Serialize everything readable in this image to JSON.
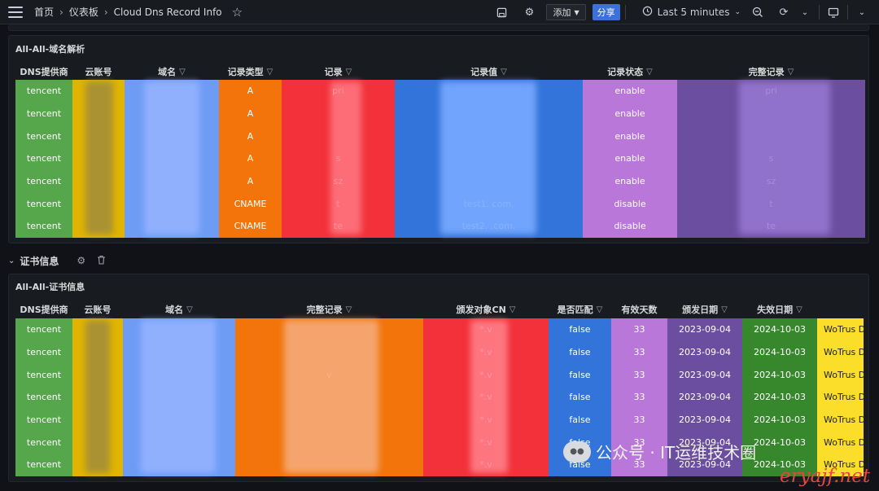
{
  "topbar": {
    "breadcrumb": [
      "首页",
      "仪表板",
      "Cloud Dns Record Info"
    ],
    "add_label": "添加",
    "share_label": "分享",
    "time_range": "Last 5 minutes",
    "icons": [
      "menu-icon",
      "star-icon",
      "save-icon",
      "settings-icon",
      "clock-icon",
      "zoom-out-icon",
      "refresh-icon",
      "tv-icon",
      "chevron-down-icon"
    ]
  },
  "dns_panel": {
    "title": "All-All-域名解析",
    "columns": [
      {
        "label": "DNS提供商",
        "filter": false,
        "color": "#56a64b"
      },
      {
        "label": "云账号",
        "filter": false,
        "color": "#e0b400"
      },
      {
        "label": "域名",
        "filter": true,
        "color": "#6e9cf5"
      },
      {
        "label": "记录类型",
        "filter": true,
        "color": "#f2740b"
      },
      {
        "label": "记录",
        "filter": true,
        "color": "#f2313a"
      },
      {
        "label": "记录值",
        "filter": true,
        "color": "#3274d9"
      },
      {
        "label": "记录状态",
        "filter": true,
        "color": "#b877d9"
      },
      {
        "label": "完整记录",
        "filter": true,
        "color": "#6c4ea0"
      }
    ],
    "rows": [
      {
        "provider": "tencent",
        "account": "",
        "domain": "",
        "type": "A",
        "record": "pri",
        "value": "",
        "status": "enable",
        "full": "pri"
      },
      {
        "provider": "tencent",
        "account": "",
        "domain": "",
        "type": "A",
        "record": "",
        "value": "",
        "status": "enable",
        "full": ""
      },
      {
        "provider": "tencent",
        "account": "",
        "domain": "",
        "type": "A",
        "record": "",
        "value": "",
        "status": "enable",
        "full": ""
      },
      {
        "provider": "tencent",
        "account": "",
        "domain": "",
        "type": "A",
        "record": "s",
        "value": "",
        "status": "enable",
        "full": "s"
      },
      {
        "provider": "tencent",
        "account": "",
        "domain": "",
        "type": "A",
        "record": "sz",
        "value": "",
        "status": "enable",
        "full": "sz"
      },
      {
        "provider": "tencent",
        "account": "",
        "domain": "",
        "type": "CNAME",
        "record": "t",
        "value": "test1.                                        com.",
        "status": "disable",
        "full": "t"
      },
      {
        "provider": "tencent",
        "account": "",
        "domain": "",
        "type": "CNAME",
        "record": "te",
        "value": "test2.                                        .com.",
        "status": "disable",
        "full": "te"
      }
    ]
  },
  "cert_row": {
    "title": "证书信息"
  },
  "cert_panel": {
    "title": "All-All-证书信息",
    "columns": [
      {
        "label": "DNS提供商",
        "filter": false,
        "color": "#56a64b"
      },
      {
        "label": "云账号",
        "filter": false,
        "color": "#e0b400"
      },
      {
        "label": "域名",
        "filter": true,
        "color": "#6e9cf5"
      },
      {
        "label": "完整记录",
        "filter": true,
        "color": "#f2740b"
      },
      {
        "label": "颁发对象CN",
        "filter": true,
        "color": "#f2313a"
      },
      {
        "label": "是否匹配",
        "filter": true,
        "color": "#3274d9"
      },
      {
        "label": "有效天数",
        "filter": false,
        "color": "#b877d9"
      },
      {
        "label": "颁发日期",
        "filter": true,
        "color": "#6c4ea0"
      },
      {
        "label": "失效日期",
        "filter": true,
        "color": "#37872d"
      },
      {
        "label": "",
        "filter": false,
        "color": "#fade2a"
      }
    ],
    "rows": [
      {
        "provider": "tencent",
        "account": "",
        "domain": "",
        "full": "",
        "cn": "*.v",
        "match": "false",
        "days": "33",
        "issued": "2023-09-04",
        "expires": "2024-10-03",
        "issuer": "WoTrus D"
      },
      {
        "provider": "tencent",
        "account": "",
        "domain": "",
        "full": "",
        "cn": "*.v",
        "match": "false",
        "days": "33",
        "issued": "2023-09-04",
        "expires": "2024-10-03",
        "issuer": "WoTrus D"
      },
      {
        "provider": "tencent",
        "account": "",
        "domain": "",
        "full": "v",
        "cn": "*.v",
        "match": "false",
        "days": "33",
        "issued": "2023-09-04",
        "expires": "2024-10-03",
        "issuer": "WoTrus D"
      },
      {
        "provider": "tencent",
        "account": "",
        "domain": "",
        "full": "",
        "cn": "*.v",
        "match": "false",
        "days": "33",
        "issued": "2023-09-04",
        "expires": "2024-10-03",
        "issuer": "WoTrus D"
      },
      {
        "provider": "tencent",
        "account": "",
        "domain": "",
        "full": "",
        "cn": "*.v",
        "match": "false",
        "days": "33",
        "issued": "2023-09-04",
        "expires": "2024-10-03",
        "issuer": "WoTrus D"
      },
      {
        "provider": "tencent",
        "account": "",
        "domain": "",
        "full": "",
        "cn": "*.v",
        "match": "false",
        "days": "33",
        "issued": "2023-09-04",
        "expires": "2024-10-03",
        "issuer": "WoTrus D"
      },
      {
        "provider": "tencent",
        "account": "",
        "domain": "",
        "full": "",
        "cn": "*.v",
        "match": "false",
        "days": "33",
        "issued": "2023-09-04",
        "expires": "2024-10-03",
        "issuer": "WoTrus D"
      }
    ]
  },
  "watermark": {
    "text": "公众号 · IT运维技术圈",
    "site": "eryajf.net"
  }
}
